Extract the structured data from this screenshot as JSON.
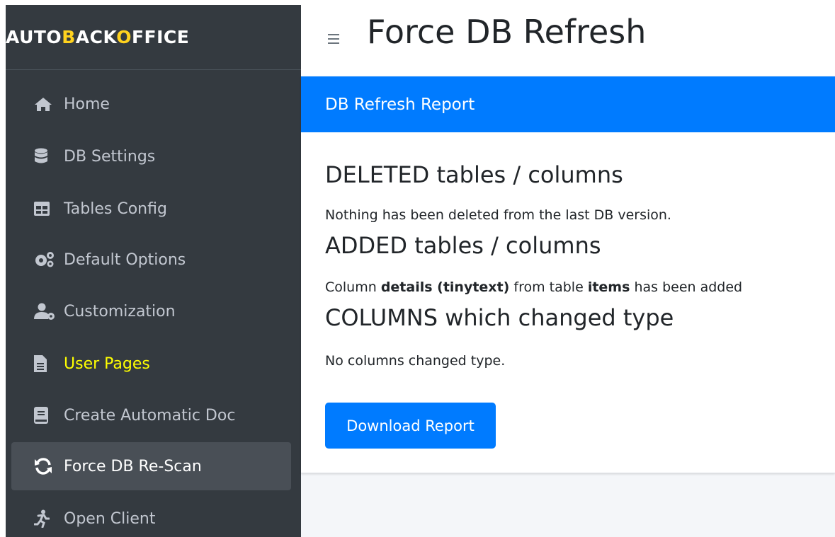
{
  "brand": {
    "part1": "AUTO",
    "part2": "B",
    "part3": "ACK",
    "part4": "O",
    "part5": "FFICE"
  },
  "sidebar": {
    "items": [
      {
        "label": "Home",
        "icon": "home-icon"
      },
      {
        "label": "DB Settings",
        "icon": "database-icon"
      },
      {
        "label": "Tables Config",
        "icon": "table-icon"
      },
      {
        "label": "Default Options",
        "icon": "cogs-icon"
      },
      {
        "label": "Customization",
        "icon": "user-cog-icon"
      },
      {
        "label": "User Pages",
        "icon": "file-icon"
      },
      {
        "label": "Create Automatic Doc",
        "icon": "book-icon"
      },
      {
        "label": "Force DB Re-Scan",
        "icon": "sync-icon",
        "active": true
      },
      {
        "label": "Open Client",
        "icon": "running-icon"
      }
    ]
  },
  "header": {
    "title": "Force DB Refresh"
  },
  "card": {
    "title": "DB Refresh Report",
    "deleted_heading": "DELETED tables / columns",
    "deleted_text": "Nothing has been deleted from the last DB version.",
    "added_heading": "ADDED tables / columns",
    "added_text": {
      "prefix": "Column ",
      "column": "details (tinytext)",
      "middle": " from table ",
      "table": "items",
      "suffix": " has been added"
    },
    "changed_heading": "COLUMNS which changed type",
    "changed_text": "No columns changed type.",
    "download_label": "Download Report"
  },
  "colors": {
    "sidebar_bg": "#343a40",
    "accent": "#007bff",
    "brand_highlight": "#ffd21e",
    "user_pages_label": "#ffff00"
  }
}
